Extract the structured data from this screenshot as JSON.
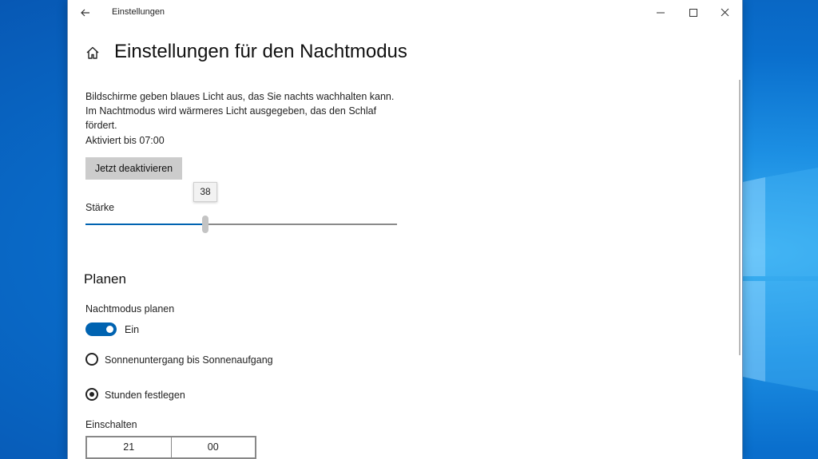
{
  "window": {
    "title": "Einstellungen"
  },
  "page": {
    "title": "Einstellungen für den Nachtmodus",
    "description": "Bildschirme geben blaues Licht aus, das Sie nachts wachhalten kann. Im Nachtmodus wird wärmeres Licht ausgegeben, das den Schlaf fördert.",
    "status": "Aktiviert bis 07:00",
    "deactivate_button": "Jetzt deaktivieren"
  },
  "strength": {
    "label": "Stärke",
    "value": "38",
    "fraction": 0.385
  },
  "schedule": {
    "heading": "Planen",
    "toggle_label": "Nachtmodus planen",
    "toggle_state": "Ein",
    "option_sunset": "Sonnenuntergang bis Sonnenaufgang",
    "option_hours": "Stunden festlegen",
    "turn_on_label": "Einschalten",
    "turn_on_hour": "21",
    "turn_on_minute": "00"
  },
  "colors": {
    "accent": "#0063b1",
    "desktop": "#0a6fcd"
  },
  "icons": [
    "back-arrow-icon",
    "minimize-icon",
    "maximize-icon",
    "close-icon",
    "home-icon"
  ]
}
